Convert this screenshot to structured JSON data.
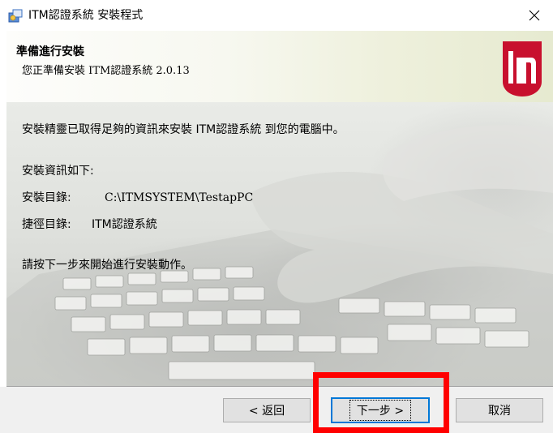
{
  "window": {
    "title": "ITM認證系統 安裝程式",
    "close_glyph": "✕"
  },
  "header": {
    "title": "準備進行安裝",
    "subtitle": "您正準備安裝 ITM認證系統 2.0.13"
  },
  "content": {
    "intro": "安裝精靈已取得足夠的資訊來安裝 ITM認證系統 到您的電腦中。",
    "info_heading": "安裝資訊如下:",
    "install_dir_label": "安裝目錄:",
    "install_dir_value": "C:\\ITMSYSTEM\\TestapPC",
    "shortcut_label": "捷徑目錄:",
    "shortcut_value": "ITM認證系統",
    "instruction": "請按下一步來開始進行安裝動作。"
  },
  "buttons": {
    "back": "< 返回",
    "next": "下一步 >",
    "cancel": "取消"
  },
  "colors": {
    "logo_red": "#c8102e",
    "highlight": "#ff0000",
    "focus_border": "#0078d7"
  },
  "icons": {
    "app": "installer-icon",
    "close": "close-icon",
    "logo": "itm-logo"
  }
}
